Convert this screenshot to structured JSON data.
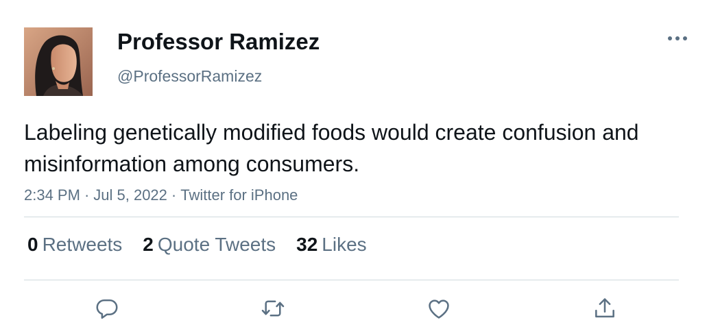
{
  "author": {
    "display_name": "Professor Ramizez",
    "handle": "@ProfessorRamizez"
  },
  "tweet": {
    "text": "Labeling genetically modified foods would create confusion and misinformation among consumers.",
    "time": "2:34 PM",
    "date": "Jul 5, 2022",
    "source": "Twitter for iPhone",
    "separator": "·"
  },
  "stats": {
    "retweets": {
      "count": "0",
      "label": "Retweets"
    },
    "quote_tweets": {
      "count": "2",
      "label": "Quote Tweets"
    },
    "likes": {
      "count": "32",
      "label": "Likes"
    }
  },
  "icons": {
    "more": "more-icon",
    "reply": "reply-icon",
    "retweet": "retweet-icon",
    "like": "heart-icon",
    "share": "share-icon"
  },
  "colors": {
    "text": "#0f1419",
    "secondary": "#5b7083",
    "divider": "#cfd9de"
  }
}
